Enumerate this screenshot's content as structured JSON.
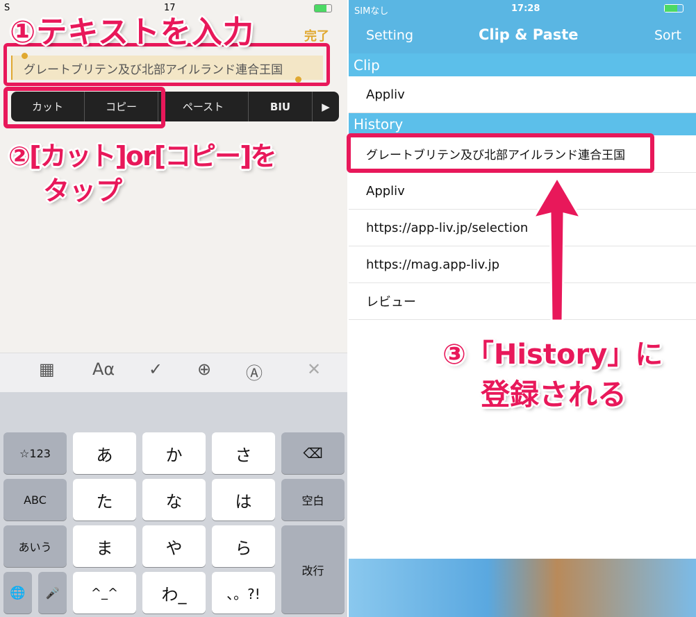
{
  "left": {
    "status": {
      "carrier": "S",
      "time": "17"
    },
    "done_label": "完了",
    "selected_text": "グレートブリテン及び北部アイルランド連合王国",
    "edit_menu": [
      "カット",
      "コピー",
      "ペースト",
      "BIU",
      "▶"
    ],
    "toolbar": {
      "table_icon": "▦",
      "font_label": "Aα",
      "check_icon": "✓",
      "plus_icon": "⊕",
      "pen_icon": "Ⓐ",
      "close_icon": "✕"
    },
    "keys": {
      "num": "☆123",
      "a": "あ",
      "ka": "か",
      "sa": "さ",
      "del": "⌫",
      "abc": "ABC",
      "ta": "た",
      "na": "な",
      "ha": "は",
      "space": "空白",
      "aiu": "あいう",
      "ma": "ま",
      "ya": "や",
      "ra": "ら",
      "enter": "改行",
      "globe": "🌐",
      "mic": "🎤",
      "kao": "^_^",
      "wa": "わ_",
      "punct": "、。?!"
    }
  },
  "right": {
    "status": {
      "carrier": "SIMなし",
      "time": "17:28"
    },
    "nav": {
      "left": "Setting",
      "title": "Clip & Paste",
      "right": "Sort"
    },
    "clip_header": "Clip",
    "clip_items": [
      "Appliv"
    ],
    "history_header": "History",
    "history_items": [
      "グレートブリテン及び北部アイルランド連合王国",
      "Appliv",
      "https://app-liv.jp/selection",
      "https://mag.app-liv.jp",
      "レビュー"
    ]
  },
  "annotations": {
    "step1": "①テキストを入力",
    "step2a": "②[カット]or[コピー]を",
    "step2b": "タップ",
    "step3a": "③「History」に",
    "step3b": "登録される"
  },
  "colors": {
    "accent": "#e8185a",
    "nav": "#5ab6e3",
    "section": "#5cbfea",
    "done": "#e0a830"
  }
}
